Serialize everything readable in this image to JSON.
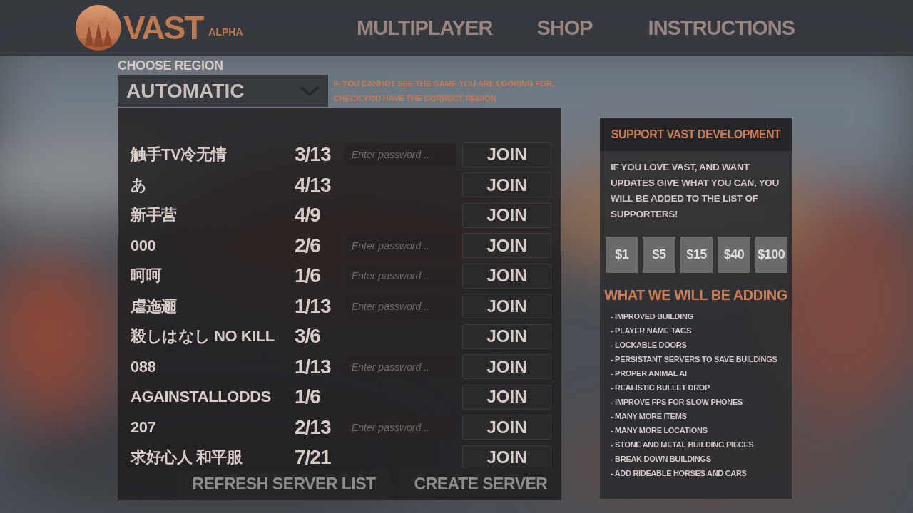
{
  "header": {
    "logo_text": "VAST",
    "badge": "ALPHA",
    "nav": [
      {
        "label": "MULTIPLAYER"
      },
      {
        "label": "SHOP"
      },
      {
        "label": "INSTRUCTIONS"
      }
    ]
  },
  "region": {
    "label": "CHOOSE REGION",
    "value": "AUTOMATIC",
    "hint": "IF YOU CANNOT SEE THE GAME YOU ARE LOOKING FOR, CHECK YOU HAVE THE CORRECT REGION"
  },
  "servers": [
    {
      "name": "触手TV冷无情",
      "players": "3/13",
      "locked": true,
      "placeholder": "Enter password...",
      "action": "JOIN"
    },
    {
      "name": "あ",
      "players": "4/13",
      "locked": false,
      "action": "JOIN"
    },
    {
      "name": "新手营",
      "players": "4/9",
      "locked": false,
      "action": "JOIN"
    },
    {
      "name": "000",
      "players": "2/6",
      "locked": true,
      "placeholder": "Enter password...",
      "action": "JOIN"
    },
    {
      "name": "呵呵",
      "players": "1/6",
      "locked": true,
      "placeholder": "Enter password...",
      "action": "JOIN"
    },
    {
      "name": "虐迤逦",
      "players": "1/13",
      "locked": true,
      "placeholder": "Enter password...",
      "action": "JOIN"
    },
    {
      "name": "殺しはなし NO KILL",
      "players": "3/6",
      "locked": false,
      "action": "JOIN"
    },
    {
      "name": "088",
      "players": "1/13",
      "locked": true,
      "placeholder": "Enter password...",
      "action": "JOIN"
    },
    {
      "name": "AGAINSTALLODDS",
      "players": "1/6",
      "locked": false,
      "action": "JOIN"
    },
    {
      "name": "207",
      "players": "2/13",
      "locked": true,
      "placeholder": "Enter password...",
      "action": "JOIN"
    },
    {
      "name": "求好心人 和平服",
      "players": "7/21",
      "locked": false,
      "action": "JOIN"
    }
  ],
  "buttons": [
    {
      "label": "REFRESH SERVER LIST"
    },
    {
      "label": "CREATE SERVER"
    }
  ],
  "support": {
    "title": "SUPPORT VAST DEVELOPMENT",
    "text": "IF YOU LOVE VAST, AND WANT UPDATES GIVE  WHAT YOU CAN, YOU WILL BE ADDED TO THE LIST OF SUPPORTERS!",
    "amounts": [
      "$1",
      "$5",
      "$15",
      "$40",
      "$100"
    ],
    "roadmap_title": "WHAT WE WILL BE ADDING",
    "roadmap": [
      "- IMPROVED BUILDING",
      "- PLAYER NAME TAGS",
      "- LOCKABLE DOORS",
      "- PERSISTANT SERVERS TO SAVE BUILDINGS",
      "- PROPER ANIMAL AI",
      "- REALISTIC BULLET DROP",
      "- IMPROVE FPS FOR SLOW PHONES",
      "- MANY MORE ITEMS",
      "- MANY MORE LOCATIONS",
      "- STONE AND METAL BUILDING PIECES",
      "- BREAK DOWN BUILDINGS",
      "- ADD RIDEABLE HORSES AND CARS"
    ]
  }
}
